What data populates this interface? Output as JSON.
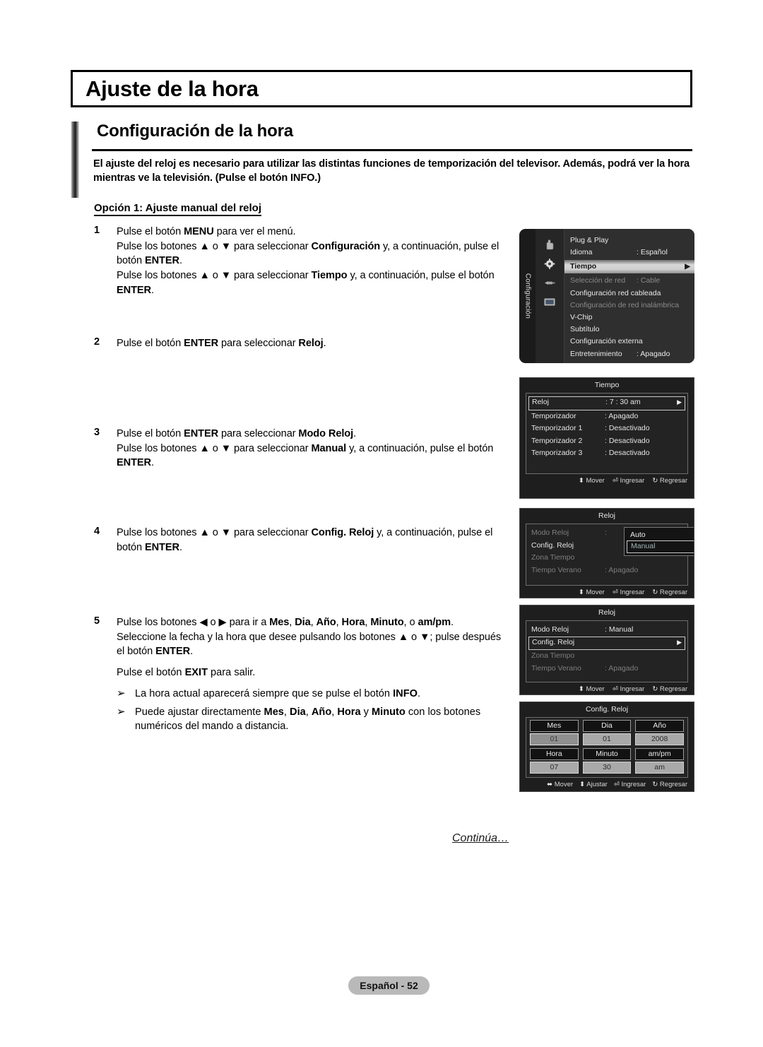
{
  "page": {
    "title": "Ajuste de la hora",
    "section_heading": "Configuración de la hora",
    "lead": "El ajuste del reloj es necesario para utilizar las distintas funciones de temporización del televisor. Además, podrá ver la hora mientras ve la televisión. (Pulse el botón INFO.)",
    "option_label": "Opción 1: Ajuste manual del reloj",
    "continue_note": "Continúa…",
    "footer": "Español - 52"
  },
  "steps": [
    {
      "num": "1",
      "lines": [
        "Pulse el botón <b>MENU</b> para ver el menú.",
        "Pulse los botones ▲ o ▼ para seleccionar <b>Configuración</b> y, a continuación, pulse el botón <b>ENTER</b>.",
        "Pulse los botones ▲ o ▼ para seleccionar <b>Tiempo</b> y, a continuación, pulse el botón <b>ENTER</b>."
      ]
    },
    {
      "num": "2",
      "lines": [
        "Pulse el botón <b>ENTER</b> para seleccionar <b>Reloj</b>."
      ]
    },
    {
      "num": "3",
      "lines": [
        "Pulse el botón <b>ENTER</b> para seleccionar <b>Modo Reloj</b>.",
        "Pulse los botones ▲ o ▼ para seleccionar <b>Manual</b> y, a continuación, pulse el botón <b>ENTER</b>."
      ]
    },
    {
      "num": "4",
      "lines": [
        "Pulse los botones ▲ o ▼ para seleccionar <b>Config. Reloj</b> y, a continuación, pulse el botón <b>ENTER</b>."
      ]
    },
    {
      "num": "5",
      "lines": [
        "Pulse los botones ◀ o ▶ para ir a <b>Mes</b>, <b>Dia</b>, <b>Año</b>, <b>Hora</b>, <b>Minuto</b>, o <b>am/pm</b>.",
        "Seleccione la fecha y la hora que desee pulsando los botones ▲ o ▼; pulse después el botón <b>ENTER</b>."
      ],
      "extra": "Pulse el botón <b>EXIT</b> para salir.",
      "notes": [
        "La hora actual aparecerá siempre que se pulse el botón <b>INFO</b>.",
        "Puede ajustar directamente <b>Mes</b>, <b>Dia</b>, <b>Año</b>, <b>Hora</b> y <b>Minuto</b> con los botones numéricos del mando a distancia."
      ]
    }
  ],
  "osd": {
    "config_menu": {
      "tab_label": "Configuración",
      "icons": [
        "hand-icon",
        "gear-icon",
        "plug-icon",
        "screen-icon"
      ],
      "rows": [
        {
          "name": "Plug & Play",
          "value": "",
          "state": "normal",
          "arrow": ""
        },
        {
          "name": "Idioma",
          "value": ": Español",
          "state": "normal",
          "arrow": ""
        },
        {
          "name": "Tiempo",
          "value": "",
          "state": "selected",
          "arrow": "▶"
        },
        {
          "name": "Selección de red",
          "value": ": Cable",
          "state": "dim",
          "arrow": ""
        },
        {
          "name": "Configuración red cableada",
          "value": "",
          "state": "normal",
          "arrow": ""
        },
        {
          "name": "Configuración de red inalámbrica",
          "value": "",
          "state": "dim",
          "arrow": ""
        },
        {
          "name": "V-Chip",
          "value": "",
          "state": "normal",
          "arrow": ""
        },
        {
          "name": "Subtítulo",
          "value": "",
          "state": "normal",
          "arrow": ""
        },
        {
          "name": "Configuración externa",
          "value": "",
          "state": "normal",
          "arrow": ""
        },
        {
          "name": "Entretenimiento",
          "value": ": Apagado",
          "state": "normal",
          "arrow": ""
        }
      ]
    },
    "tiempo_menu": {
      "title": "Tiempo",
      "rows": [
        {
          "label": "Reloj",
          "value": ": 7 : 30 am",
          "state": "boxed",
          "arrow": "▶"
        },
        {
          "label": "Temporizador",
          "value": ": Apagado",
          "state": "normal",
          "arrow": ""
        },
        {
          "label": "Temporizador 1",
          "value": ": Desactivado",
          "state": "normal",
          "arrow": ""
        },
        {
          "label": "Temporizador 2",
          "value": ": Desactivado",
          "state": "normal",
          "arrow": ""
        },
        {
          "label": "Temporizador 3",
          "value": ": Desactivado",
          "state": "normal",
          "arrow": ""
        }
      ],
      "footer": [
        {
          "icon": "updown-icon",
          "glyph": "⬍",
          "label": "Mover"
        },
        {
          "icon": "enter-icon",
          "glyph": "⏎",
          "label": "Ingresar"
        },
        {
          "icon": "return-icon",
          "glyph": "↻",
          "label": "Regresar"
        }
      ]
    },
    "reloj_menu_dropdown": {
      "title": "Reloj",
      "rows": [
        {
          "label": "Modo Reloj",
          "value": ":",
          "state": "dim",
          "arrow": ""
        },
        {
          "label": "Config. Reloj",
          "value": "",
          "state": "normal",
          "arrow": ""
        },
        {
          "label": "Zona Tiempo",
          "value": "",
          "state": "dim",
          "arrow": ""
        },
        {
          "label": "Tiempo Verano",
          "value": ": Apagado",
          "state": "dim",
          "arrow": ""
        }
      ],
      "dropdown": {
        "options": [
          "Auto",
          "Manual"
        ],
        "selected": "Manual"
      },
      "footer": [
        {
          "icon": "updown-icon",
          "glyph": "⬍",
          "label": "Mover"
        },
        {
          "icon": "enter-icon",
          "glyph": "⏎",
          "label": "Ingresar"
        },
        {
          "icon": "return-icon",
          "glyph": "↻",
          "label": "Regresar"
        }
      ]
    },
    "reloj_menu_config": {
      "title": "Reloj",
      "rows": [
        {
          "label": "Modo Reloj",
          "value": ": Manual",
          "state": "normal",
          "arrow": ""
        },
        {
          "label": "Config. Reloj",
          "value": "",
          "state": "boxed",
          "arrow": "▶"
        },
        {
          "label": "Zona Tiempo",
          "value": "",
          "state": "dim",
          "arrow": ""
        },
        {
          "label": "Tiempo Verano",
          "value": ": Apagado",
          "state": "dim",
          "arrow": ""
        }
      ],
      "footer": [
        {
          "icon": "updown-icon",
          "glyph": "⬍",
          "label": "Mover"
        },
        {
          "icon": "enter-icon",
          "glyph": "⏎",
          "label": "Ingresar"
        },
        {
          "icon": "return-icon",
          "glyph": "↻",
          "label": "Regresar"
        }
      ]
    },
    "config_reloj_menu": {
      "title": "Config. Reloj",
      "fields": [
        {
          "head": "Mes",
          "value": "01",
          "selected": true
        },
        {
          "head": "Dia",
          "value": "01",
          "selected": false
        },
        {
          "head": "Año",
          "value": "2008",
          "selected": false
        },
        {
          "head": "Hora",
          "value": "07",
          "selected": false
        },
        {
          "head": "Minuto",
          "value": "30",
          "selected": false
        },
        {
          "head": "am/pm",
          "value": "am",
          "selected": false
        }
      ],
      "footer": [
        {
          "icon": "leftright-icon",
          "glyph": "⬌",
          "label": "Mover"
        },
        {
          "icon": "updown-icon",
          "glyph": "⬍",
          "label": "Ajustar"
        },
        {
          "icon": "enter-icon",
          "glyph": "⏎",
          "label": "Ingresar"
        },
        {
          "icon": "return-icon",
          "glyph": "↻",
          "label": "Regresar"
        }
      ]
    }
  }
}
